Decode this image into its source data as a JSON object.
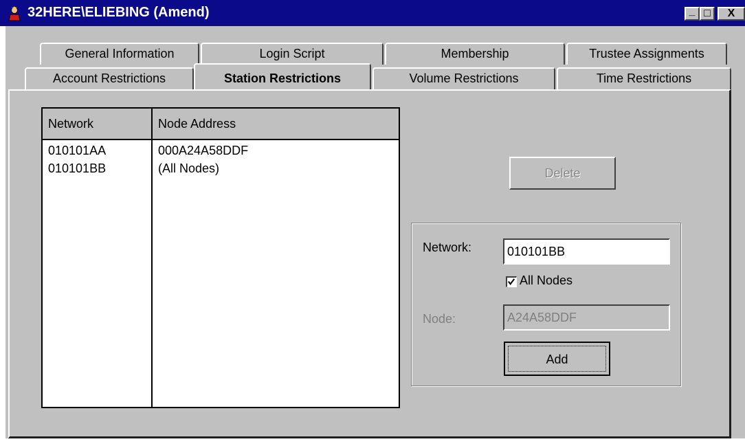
{
  "window": {
    "title": "32HERE\\ELIEBING (Amend)",
    "minimize_glyph": "_",
    "maximize_glyph": "□",
    "close_glyph": "X"
  },
  "tabs_row1": [
    {
      "label": "General Information"
    },
    {
      "label": "Login Script"
    },
    {
      "label": "Membership"
    },
    {
      "label": "Trustee Assignments"
    }
  ],
  "tabs_row2": [
    {
      "label": "Account Restrictions"
    },
    {
      "label": "Station Restrictions"
    },
    {
      "label": "Volume Restrictions"
    },
    {
      "label": "Time Restrictions"
    }
  ],
  "active_tab": "Station Restrictions",
  "list": {
    "columns": [
      "Network",
      "Node Address"
    ],
    "rows": [
      [
        "010101AA",
        "000A24A58DDF"
      ],
      [
        "010101BB",
        "(All Nodes)"
      ]
    ]
  },
  "buttons": {
    "delete_label": "Delete",
    "add_label": "Add"
  },
  "form": {
    "network_label": "Network:",
    "network_value": "010101BB",
    "all_nodes_label": "All Nodes",
    "all_nodes_checked": true,
    "node_label": "Node:",
    "node_value": "A24A58DDF"
  },
  "colors": {
    "title_bar": "#0a0a8a",
    "face": "#c0c0c0"
  }
}
